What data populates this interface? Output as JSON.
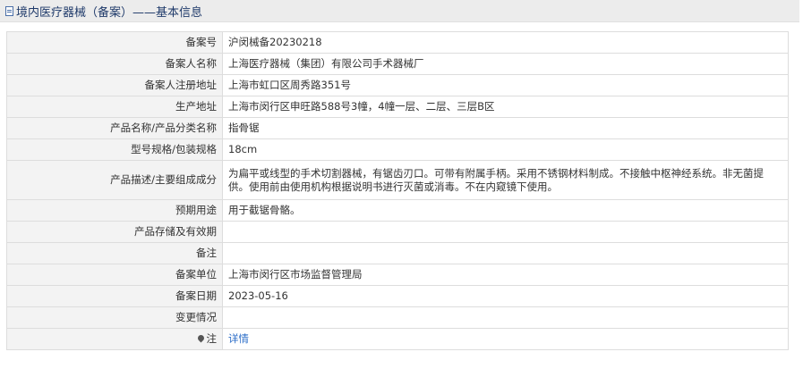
{
  "header": {
    "title": "境内医疗器械（备案）——基本信息"
  },
  "rows": [
    {
      "label": "备案号",
      "value": "沪闵械备20230218"
    },
    {
      "label": "备案人名称",
      "value": "上海医疗器械（集团）有限公司手术器械厂"
    },
    {
      "label": "备案人注册地址",
      "value": "上海市虹口区周秀路351号"
    },
    {
      "label": "生产地址",
      "value": "上海市闵行区申旺路588号3幢，4幢一层、二层、三层B区"
    },
    {
      "label": "产品名称/产品分类名称",
      "value": "指骨锯"
    },
    {
      "label": "型号规格/包装规格",
      "value": "18cm"
    },
    {
      "label": "产品描述/主要组成成分",
      "value": "为扁平或线型的手术切割器械，有锯齿刃口。可带有附属手柄。采用不锈钢材料制成。不接触中枢神经系统。非无菌提供。使用前由使用机构根据说明书进行灭菌或消毒。不在内窥镜下使用。"
    },
    {
      "label": "预期用途",
      "value": "用于截锯骨骼。"
    },
    {
      "label": "产品存储及有效期",
      "value": ""
    },
    {
      "label": "备注",
      "value": ""
    },
    {
      "label": "备案单位",
      "value": "上海市闵行区市场监督管理局"
    },
    {
      "label": "备案日期",
      "value": "2023-05-16"
    },
    {
      "label": "变更情况",
      "value": ""
    }
  ],
  "note": {
    "label": "注",
    "link": "详情"
  }
}
